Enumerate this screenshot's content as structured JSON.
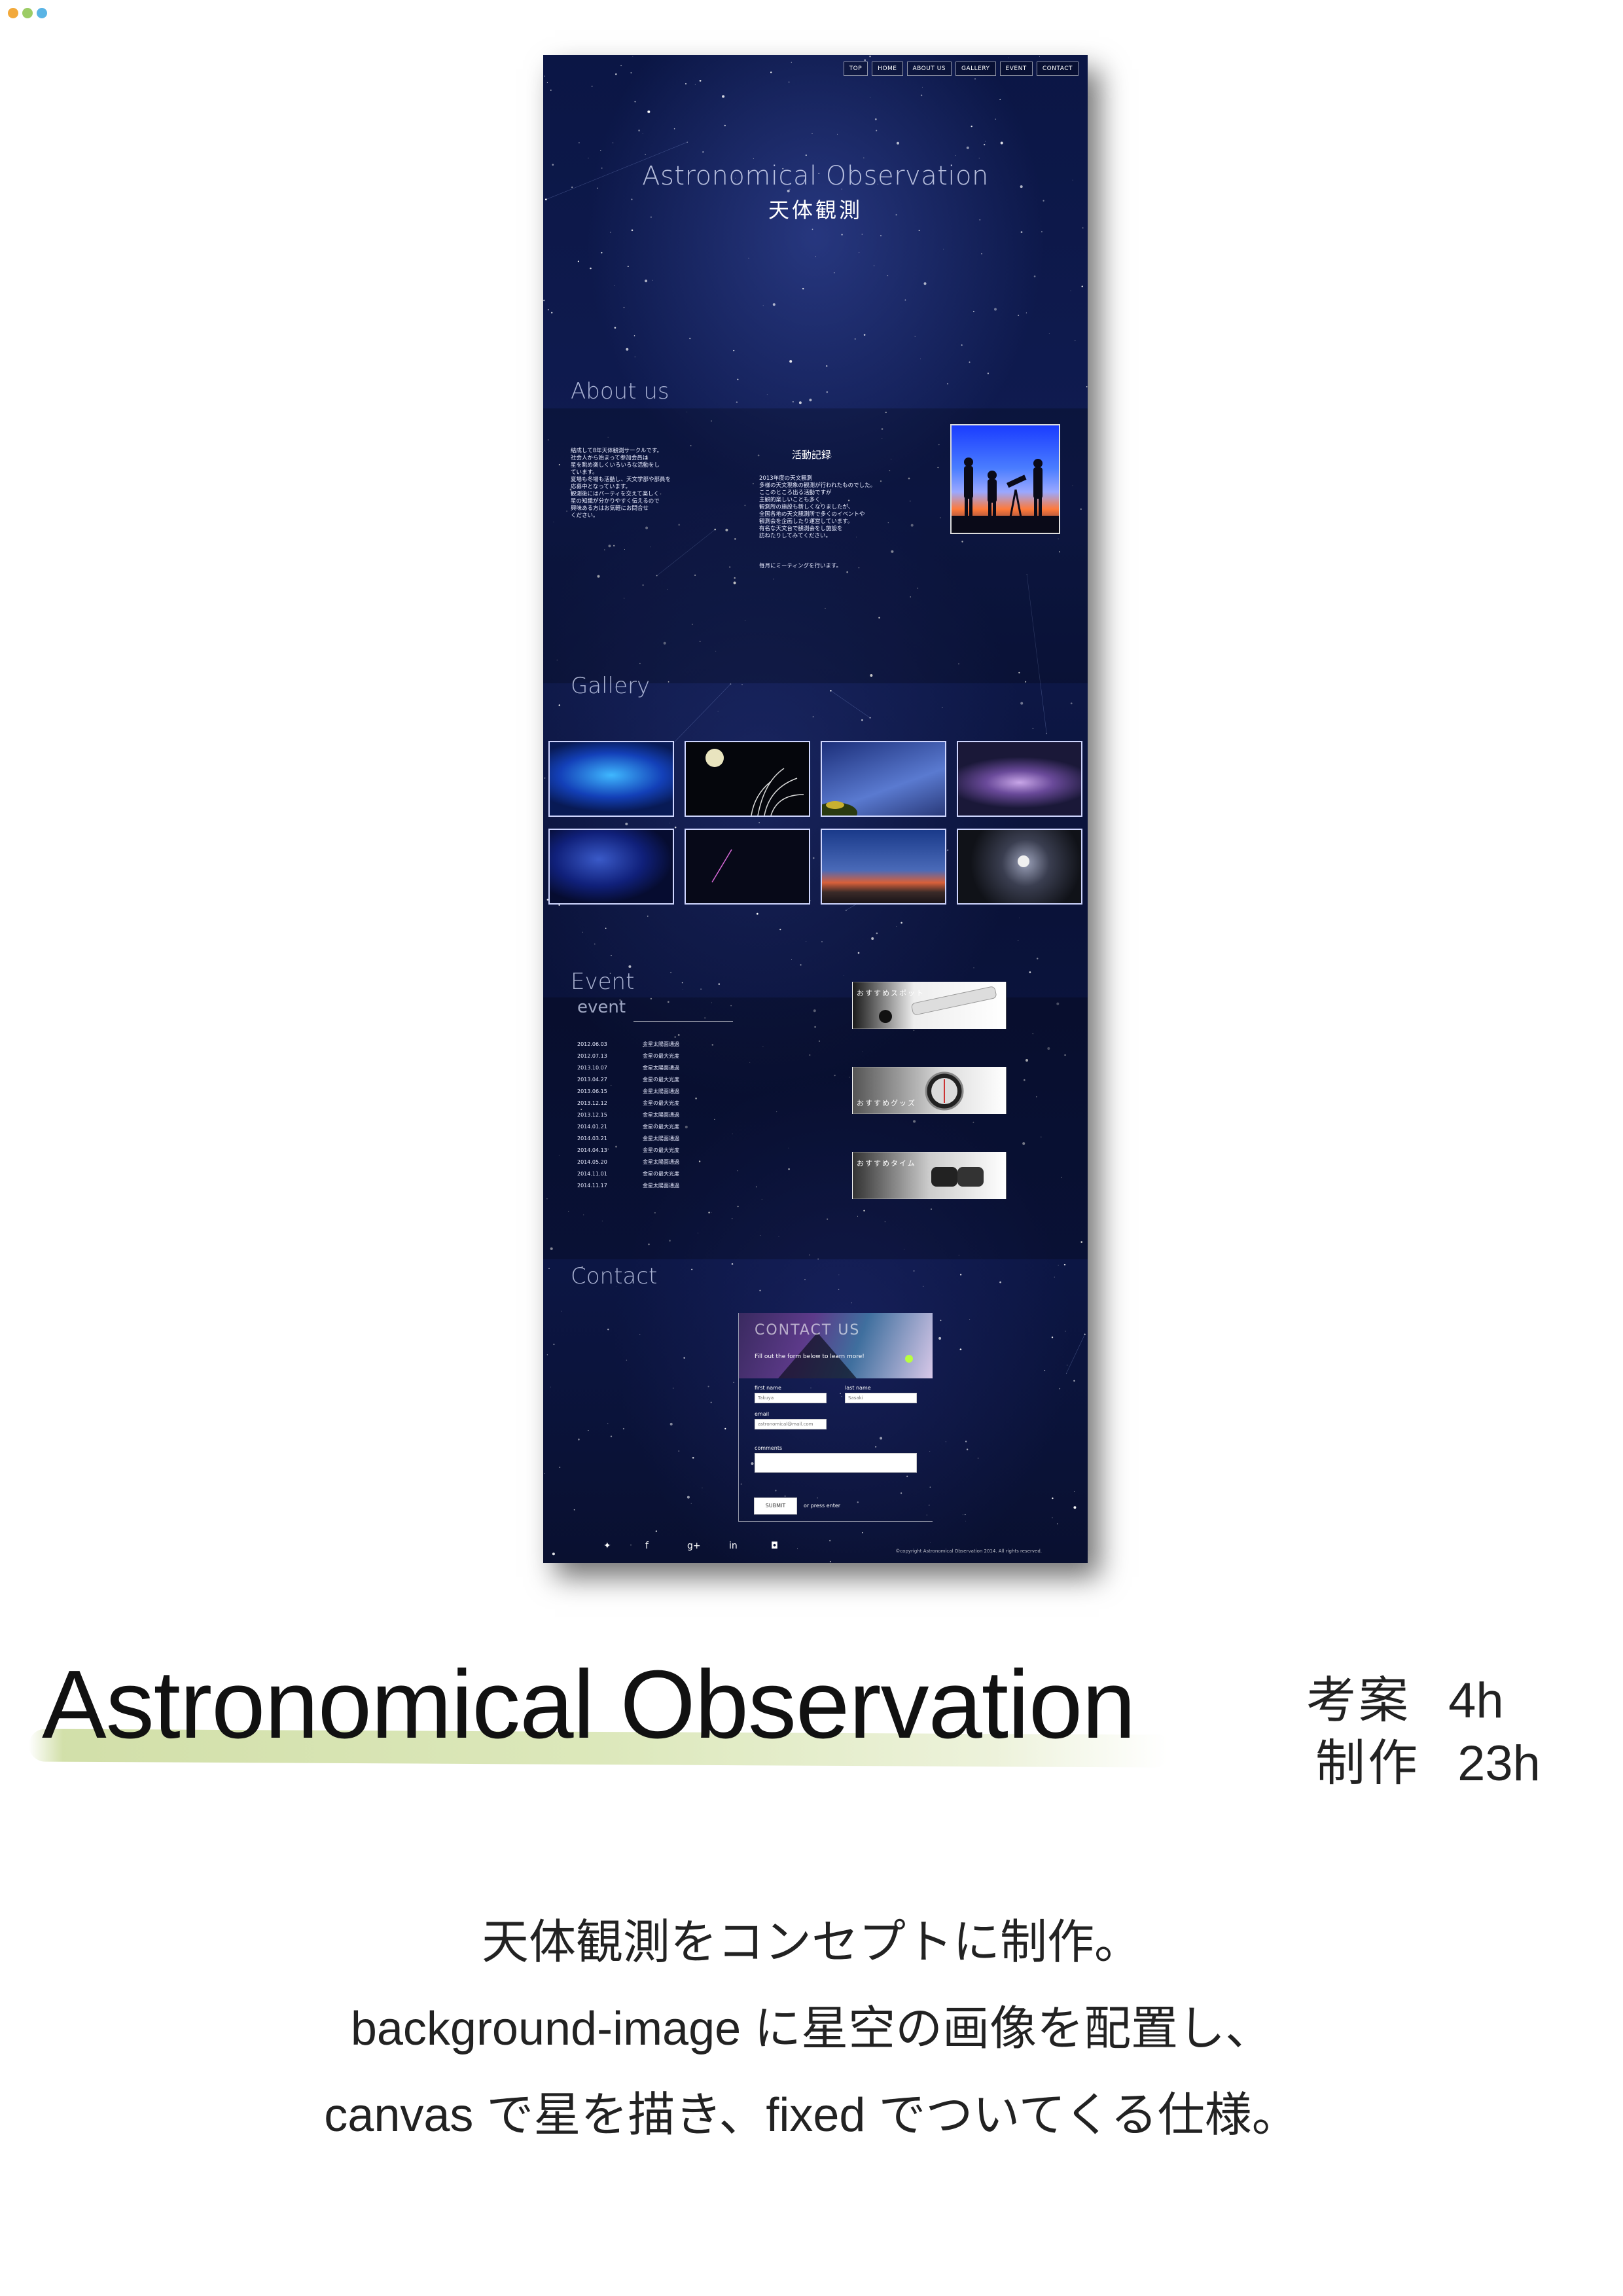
{
  "window": {
    "dot_colors": [
      "#f2a93b",
      "#9ccc65",
      "#5ab4e5"
    ]
  },
  "site": {
    "nav": [
      "TOP",
      "HOME",
      "ABOUT US",
      "GALLERY",
      "EVENT",
      "CONTACT"
    ],
    "hero": {
      "title_en": "Astronomical Observation",
      "title_ja": "天体観測"
    },
    "about": {
      "title": "About us",
      "intro": "結成して8年天体観測サークルです。\n社会人から始まって参加会員は\n星を眺め楽しくいろいろな活動をし\nています。\n夏場も冬場も活動し、天文学部や部員を\n応募中となっています。\n観測後にはパーティを交えて楽しく\n星の知識が分かりやすく伝えるので\n興味ある方はお気軽にお問合せ\nください。",
      "activity_heading": "活動記録",
      "activity_text": "2013年度の天文観測\n多様の天文現象の観測が行われたものでした。\nここのところ出る活動ですが\n主観的楽しいことも多く\n観測所の施設も新しくなりましたが、\n全国各地の天文観測所で多くのイベントや\n観測会を企画したり運営しています。\n有名な天文台で観測会をし施設を\n訪ねたりしてみてください。",
      "meeting_note": "毎月にミーティングを行います。"
    },
    "gallery": {
      "title": "Gallery"
    },
    "event": {
      "title": "Event",
      "subtitle": "event",
      "rows": [
        {
          "date": "2012.06.03",
          "place": "金星太陽面通過"
        },
        {
          "date": "2012.07.13",
          "place": "金星の最大光度"
        },
        {
          "date": "2013.10.07",
          "place": "金星太陽面通過"
        },
        {
          "date": "2013.04.27",
          "place": "金星の最大光度"
        },
        {
          "date": "2013.06.15",
          "place": "金星太陽面通過"
        },
        {
          "date": "2013.12.12",
          "place": "金星の最大光度"
        },
        {
          "date": "2013.12.15",
          "place": "金星太陽面通過"
        },
        {
          "date": "2014.01.21",
          "place": "金星の最大光度"
        },
        {
          "date": "2014.03.21",
          "place": "金星太陽面通過"
        },
        {
          "date": "2014.04.13",
          "place": "金星の最大光度"
        },
        {
          "date": "2014.05.20",
          "place": "金星太陽面通過"
        },
        {
          "date": "2014.11.01",
          "place": "金星の最大光度"
        },
        {
          "date": "2014.11.17",
          "place": "金星太陽面通過"
        }
      ],
      "recommend": [
        "おすすめスポット",
        "おすすめグッズ",
        "おすすめタイム"
      ]
    },
    "contact": {
      "title": "Contact",
      "banner_title": "CONTACT US",
      "banner_sub": "Fill out the form below to learn more!",
      "first_name_label": "first name",
      "first_name_placeholder": "Takuya",
      "last_name_label": "last name",
      "last_name_placeholder": "Sasaki",
      "email_label": "email",
      "email_placeholder": "astronomical@mail.com",
      "comments_label": "comments",
      "submit_label": "SUBMIT",
      "press_enter": "or press enter"
    },
    "footer": {
      "social": [
        "twitter-icon",
        "facebook-icon",
        "google-plus-icon",
        "linkedin-icon",
        "instagram-icon"
      ],
      "copyright": "©copyright Astronomical Observation 2014. All rights reserved."
    }
  },
  "portfolio": {
    "title": "Astronomical Observation",
    "plan_label": "考案",
    "plan_hours": "4h",
    "build_label": "制作",
    "build_hours": "23h",
    "description": [
      "天体観測をコンセプトに制作。",
      "background-image に星空の画像を配置し、",
      "canvas で星を描き、fixed でついてくる仕様。"
    ]
  }
}
